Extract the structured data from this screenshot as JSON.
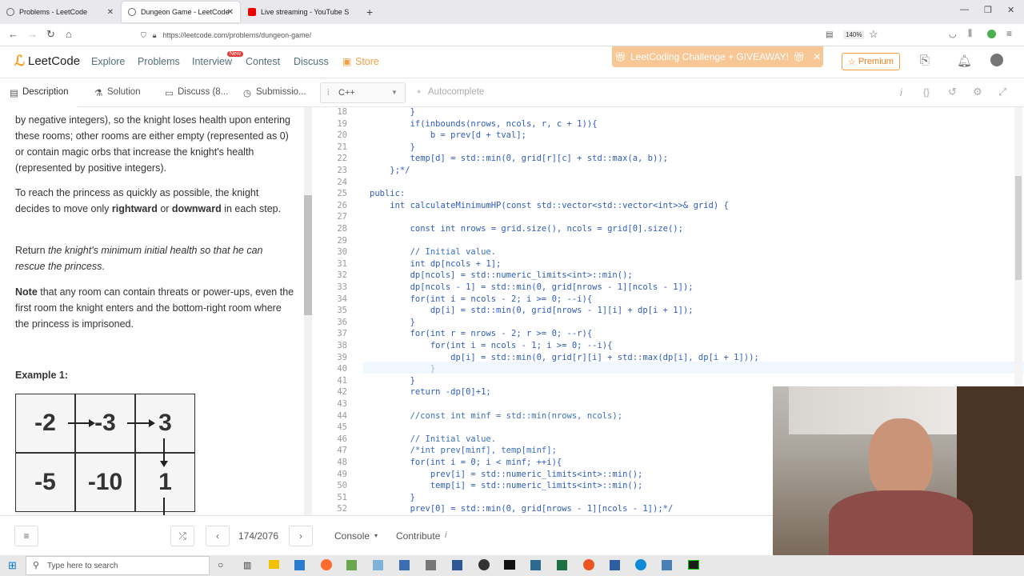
{
  "browser": {
    "tabs": [
      {
        "title": "Problems - LeetCode",
        "active": false
      },
      {
        "title": "Dungeon Game - LeetCode",
        "active": true
      },
      {
        "title": "Live streaming - YouTube Studio",
        "active": false
      }
    ],
    "url": "https://leetcode.com/problems/dungeon-game/",
    "zoom": "140%"
  },
  "header": {
    "logo": "LeetCode",
    "nav": [
      "Explore",
      "Problems",
      "Interview",
      "Contest",
      "Discuss",
      "Store"
    ],
    "new_badge": "New",
    "challenge": "LeetCoding Challenge + GIVEAWAY!",
    "premium": "Premium"
  },
  "subtabs": {
    "description": "Description",
    "solution": "Solution",
    "discuss": "Discuss (8...",
    "submissions": "Submissio...",
    "language": "C++",
    "autocomplete": "Autocomplete"
  },
  "description": {
    "p1": "by negative integers), so the knight loses health upon entering these rooms; other rooms are either empty (represented as 0) or contain magic orbs that increase the knight's health (represented by positive integers).",
    "p2_a": "To reach the princess as quickly as possible, the knight decides to move only ",
    "p2_b": "rightward",
    "p2_c": " or ",
    "p2_d": "downward",
    "p2_e": " in each step.",
    "p3_a": "Return ",
    "p3_b": "the knight's minimum initial health so that he can rescue the princess",
    "p3_c": ".",
    "p4_a": "Note",
    "p4_b": " that any room can contain threats or power-ups, even the first room the knight enters and the bottom-right room where the princess is imprisoned.",
    "example": "Example 1:",
    "grid": [
      [
        "-2",
        "-3",
        "3"
      ],
      [
        "-5",
        "-10",
        "1"
      ]
    ]
  },
  "code": [
    {
      "n": "18",
      "t": "        }"
    },
    {
      "n": "19",
      "t": "        if(inbounds(nrows, ncols, r, c + 1)){"
    },
    {
      "n": "20",
      "t": "            b = prev[d + tval];"
    },
    {
      "n": "21",
      "t": "        }"
    },
    {
      "n": "22",
      "t": "        temp[d] = std::min(0, grid[r][c] + std::max(a, b));"
    },
    {
      "n": "23",
      "t": "    };*/"
    },
    {
      "n": "24",
      "t": ""
    },
    {
      "n": "25",
      "t": "public:"
    },
    {
      "n": "26",
      "t": "    int calculateMinimumHP(const std::vector<std::vector<int>>& grid) {"
    },
    {
      "n": "27",
      "t": ""
    },
    {
      "n": "28",
      "t": "        const int nrows = grid.size(), ncols = grid[0].size();"
    },
    {
      "n": "29",
      "t": ""
    },
    {
      "n": "30",
      "t": "        // Initial value."
    },
    {
      "n": "31",
      "t": "        int dp[ncols + 1];"
    },
    {
      "n": "32",
      "t": "        dp[ncols] = std::numeric_limits<int>::min();"
    },
    {
      "n": "33",
      "t": "        dp[ncols - 1] = std::min(0, grid[nrows - 1][ncols - 1]);"
    },
    {
      "n": "34",
      "t": "        for(int i = ncols - 2; i >= 0; --i){"
    },
    {
      "n": "35",
      "t": "            dp[i] = std::min(0, grid[nrows - 1][i] + dp[i + 1]);"
    },
    {
      "n": "36",
      "t": "        }"
    },
    {
      "n": "37",
      "t": "        for(int r = nrows - 2; r >= 0; --r){"
    },
    {
      "n": "38",
      "t": "            for(int i = ncols - 1; i >= 0; --i){"
    },
    {
      "n": "39",
      "t": "                dp[i] = std::min(0, grid[r][i] + std::max(dp[i], dp[i + 1]));"
    },
    {
      "n": "40",
      "t": "            }"
    },
    {
      "n": "41",
      "t": "        }"
    },
    {
      "n": "42",
      "t": "        return -dp[0]+1;"
    },
    {
      "n": "43",
      "t": ""
    },
    {
      "n": "44",
      "t": "        //const int minf = std::min(nrows, ncols);"
    },
    {
      "n": "45",
      "t": ""
    },
    {
      "n": "46",
      "t": "        // Initial value."
    },
    {
      "n": "47",
      "t": "        /*int prev[minf], temp[minf];"
    },
    {
      "n": "48",
      "t": "        for(int i = 0; i < minf; ++i){"
    },
    {
      "n": "49",
      "t": "            prev[i] = std::numeric_limits<int>::min();"
    },
    {
      "n": "50",
      "t": "            temp[i] = std::numeric_limits<int>::min();"
    },
    {
      "n": "51",
      "t": "        }"
    },
    {
      "n": "52",
      "t": "        prev[0] = std::min(0, grid[nrows - 1][ncols - 1]);*/"
    }
  ],
  "footer": {
    "page": "174/2076",
    "console": "Console",
    "contribute": "Contribute"
  },
  "taskbar": {
    "search": "Type here to search"
  }
}
